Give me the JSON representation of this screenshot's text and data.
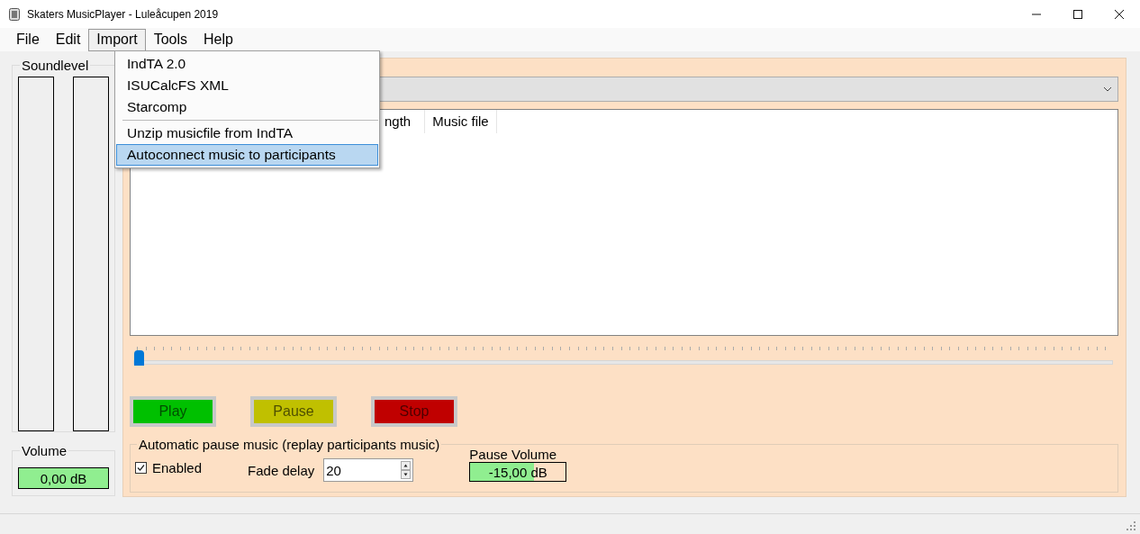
{
  "window": {
    "title": "Skaters MusicPlayer - Luleåcupen 2019"
  },
  "menu_bar": [
    {
      "label": "File",
      "selected": false
    },
    {
      "label": "Edit",
      "selected": false
    },
    {
      "label": "Import",
      "selected": true
    },
    {
      "label": "Tools",
      "selected": false
    },
    {
      "label": "Help",
      "selected": false
    }
  ],
  "dropdown_menu": [
    {
      "label": "IndTA 2.0",
      "selected": false,
      "separator_before": false
    },
    {
      "label": "ISUCalcFS XML",
      "selected": false,
      "separator_before": false
    },
    {
      "label": "Starcomp",
      "selected": false,
      "separator_before": false
    },
    {
      "label": "Unzip musicfile from IndTA",
      "selected": false,
      "separator_before": true
    },
    {
      "label": "Autoconnect music to participants",
      "selected": true,
      "separator_before": false
    }
  ],
  "soundlevels": {
    "title": "Soundlevel"
  },
  "volume": {
    "title": "Volume",
    "reading": "0,00 dB"
  },
  "list": {
    "columns": [
      "ngth",
      "Music file"
    ]
  },
  "position_slider": {
    "level": 0
  },
  "buttons": [
    {
      "label": "Play",
      "color": "#00c000"
    },
    {
      "label": "Pause",
      "color": "#c0c000"
    },
    {
      "label": "Stop",
      "color": "#c00000"
    }
  ],
  "pause_music": {
    "title": "Automatic pause music (replay participants music)",
    "enabled": {
      "label": "Enabled",
      "checked": true
    },
    "fade_delay": {
      "label": "Fade delay",
      "value": "20"
    },
    "pause_volume": {
      "label": "Pause Volume",
      "reading": "-15,00 dB",
      "level": 0.67
    }
  }
}
